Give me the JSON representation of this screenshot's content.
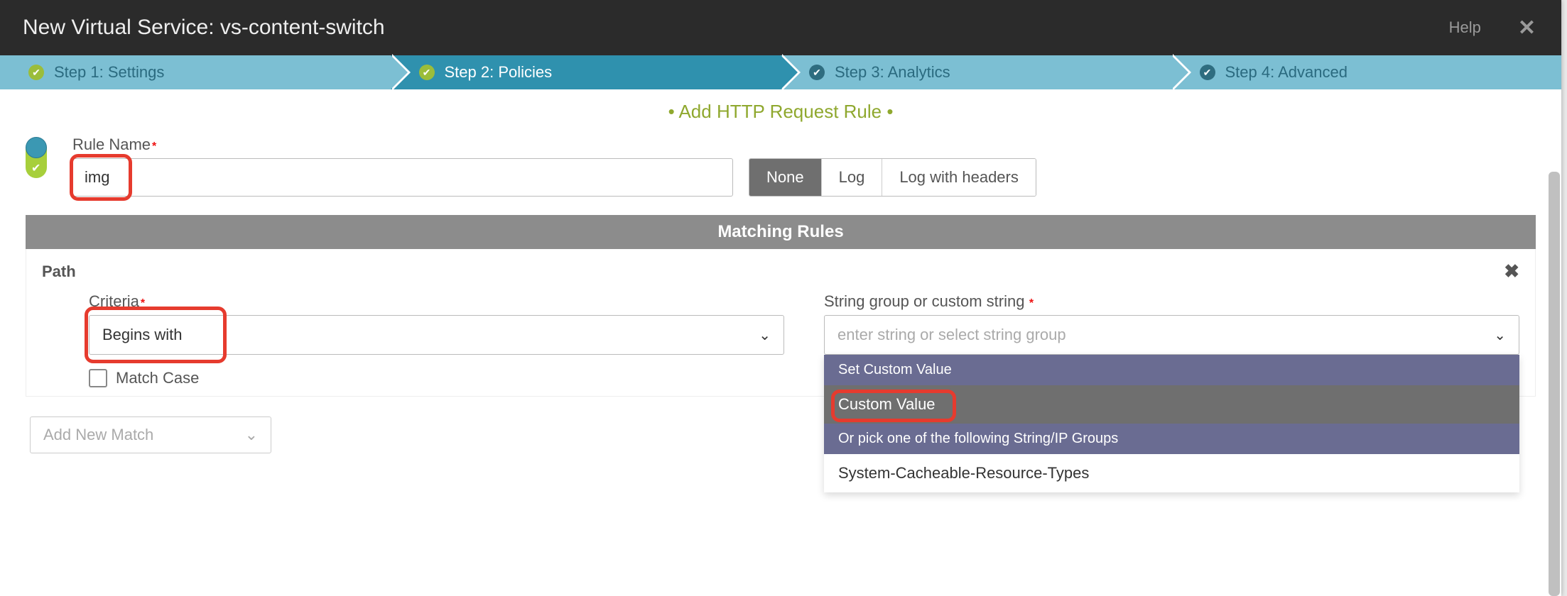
{
  "header": {
    "title": "New Virtual Service: vs-content-switch",
    "help": "Help"
  },
  "steps": [
    {
      "label": "Step 1: Settings",
      "state": "done"
    },
    {
      "label": "Step 2: Policies",
      "state": "active"
    },
    {
      "label": "Step 3: Analytics",
      "state": "todo"
    },
    {
      "label": "Step 4: Advanced",
      "state": "todo"
    }
  ],
  "add_rule_header": "• Add HTTP Request Rule •",
  "rule": {
    "name_label": "Rule Name",
    "name_value": "img",
    "log_options": [
      "None",
      "Log",
      "Log with headers"
    ],
    "log_selected": "None"
  },
  "matching": {
    "section_title": "Matching Rules",
    "type_label": "Path",
    "criteria_label": "Criteria",
    "criteria_value": "Begins with",
    "match_case_label": "Match Case",
    "string_label": "String group or custom string",
    "string_placeholder": "enter string or select string group",
    "dropdown": {
      "header1": "Set Custom Value",
      "custom_value": "Custom Value",
      "header2": "Or pick one of the following String/IP Groups",
      "group1": "System-Cacheable-Resource-Types"
    },
    "add_new_match": "Add New Match"
  }
}
